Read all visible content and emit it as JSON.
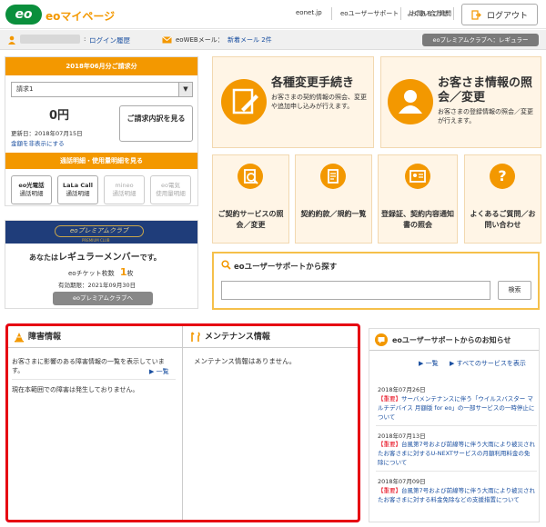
{
  "header": {
    "logo_text": "eo",
    "site_title": "eoマイページ",
    "nav": [
      "eonet.jp",
      "eoユーザーサポート",
      "よくあるご質問",
      "お問い合わせ"
    ],
    "logout_label": "ログアウト"
  },
  "userbar": {
    "user_name": "●様",
    "login_history": "ログイン履歴",
    "webmail_label": "eoWEBメール：",
    "new_mail": "新着メール 2件",
    "premium_status": "eoプレミアムクラブへ：レギュラー"
  },
  "billing": {
    "title": "2018年06月分ご請求分",
    "select_value": "請求1",
    "amount": "0円",
    "update_date": "更新日：2018年07月15日",
    "hide_amount": "金額を非表示にする",
    "detail_button": "ご請求内訳を見る",
    "usage_title": "通話明細・使用量明細を見る",
    "services": [
      {
        "name": "eo光電話",
        "sub": "通話明細",
        "disabled": false
      },
      {
        "name": "LaLa Call",
        "sub": "通話明細",
        "disabled": false
      },
      {
        "name": "mineo",
        "sub": "通話明細",
        "disabled": true
      },
      {
        "name": "eo電気",
        "sub": "使用量明細",
        "disabled": true
      }
    ]
  },
  "club": {
    "logo": "eoプレミアムクラブ",
    "logo_sub": "PREMIUM CLUB",
    "member_prefix": "あなたは",
    "member_rank": "レギュラーメンバー",
    "member_suffix": "です。",
    "ticket_label": "eoチケット枚数",
    "ticket_count": "1",
    "ticket_unit": "枚",
    "expiry": "有効期限：2021年09月30日",
    "button": "eoプレミアムクラブへ"
  },
  "tiles": {
    "change": {
      "title": "各種変更手続き",
      "desc": "お客さまの契約情報の照会、変更や追加申し込みが行えます。"
    },
    "customer": {
      "title": "お客さま情報の照会／変更",
      "desc": "お客さまの登録情報の照会／変更が行えます。"
    },
    "small": [
      {
        "label": "ご契約サービスの照会／変更",
        "icon": "magnifier-icon"
      },
      {
        "label": "契約約款／規約一覧",
        "icon": "document-icon"
      },
      {
        "label": "登録証、契約内容通知書の照会",
        "icon": "card-icon"
      },
      {
        "label": "よくあるご質問／お問い合わせ",
        "icon": "question-icon"
      }
    ]
  },
  "search": {
    "title": "eoユーザーサポートから探す",
    "placeholder": "",
    "button": "検索"
  },
  "trouble": {
    "title": "障害情報",
    "desc": "お客さまに影響のある障害情報の一覧を表示しています。",
    "list_link": "一覧",
    "status": "現在本範囲での障害は発生しておりません。"
  },
  "maintenance": {
    "title": "メンテナンス情報",
    "status": "メンテナンス情報はありません。"
  },
  "news": {
    "title": "eoユーザーサポートからのお知らせ",
    "list_link": "一覧",
    "all_services_link": "すべてのサービスを表示",
    "items": [
      {
        "date": "2018年07月26日",
        "tag": "【重要】",
        "text": "サーバメンテナンスに伴う「ウイルスバスター マルチデバイス 月額版 for eo」の一部サービスの一時停止について"
      },
      {
        "date": "2018年07月13日",
        "tag": "【重要】",
        "text": "台風第7号および前線等に伴う大雨により被災されたお客さまに対するU-NEXTサービスの月額利用料金の免除について"
      },
      {
        "date": "2018年07月09日",
        "tag": "【重要】",
        "text": "台風第7号および前線等に伴う大雨により被災されたお客さまに対する料金免除などの支援措置について"
      }
    ]
  }
}
